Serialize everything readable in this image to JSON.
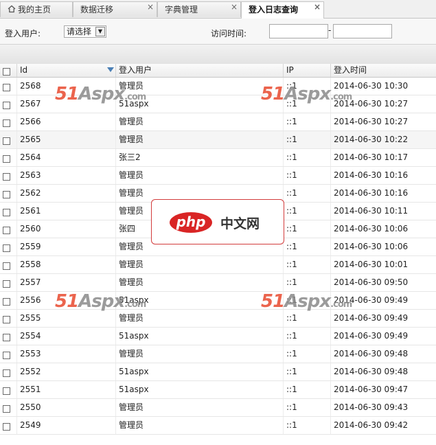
{
  "tabs": [
    {
      "label": "我的主页",
      "icon": "home-icon",
      "closable": false,
      "active": false
    },
    {
      "label": "数据迁移",
      "closable": true,
      "active": false
    },
    {
      "label": "字典管理",
      "closable": true,
      "active": false
    },
    {
      "label": "登入日志查询",
      "closable": true,
      "active": true
    }
  ],
  "close_glyph": "×",
  "filter": {
    "user_label": "登入用户:",
    "user_select_value": "请选择",
    "time_label": "访问时间:",
    "range_separator": "-"
  },
  "grid": {
    "columns": [
      "Id",
      "登入用户",
      "IP",
      "登入时间"
    ],
    "sort_column": "Id",
    "rows": [
      {
        "id": "2568",
        "user": "管理员",
        "ip": "::1",
        "time": "2014-06-30 10:30"
      },
      {
        "id": "2567",
        "user": "51aspx",
        "ip": "::1",
        "time": "2014-06-30 10:27"
      },
      {
        "id": "2566",
        "user": "管理员",
        "ip": "::1",
        "time": "2014-06-30 10:27"
      },
      {
        "id": "2565",
        "user": "管理员",
        "ip": "::1",
        "time": "2014-06-30 10:22"
      },
      {
        "id": "2564",
        "user": "张三2",
        "ip": "::1",
        "time": "2014-06-30 10:17"
      },
      {
        "id": "2563",
        "user": "管理员",
        "ip": "::1",
        "time": "2014-06-30 10:16"
      },
      {
        "id": "2562",
        "user": "管理员",
        "ip": "::1",
        "time": "2014-06-30 10:16"
      },
      {
        "id": "2561",
        "user": "管理员",
        "ip": "::1",
        "time": "2014-06-30 10:11"
      },
      {
        "id": "2560",
        "user": "张四",
        "ip": "::1",
        "time": "2014-06-30 10:06"
      },
      {
        "id": "2559",
        "user": "管理员",
        "ip": "::1",
        "time": "2014-06-30 10:06"
      },
      {
        "id": "2558",
        "user": "管理员",
        "ip": "::1",
        "time": "2014-06-30 10:01"
      },
      {
        "id": "2557",
        "user": "管理员",
        "ip": "::1",
        "time": "2014-06-30 09:50"
      },
      {
        "id": "2556",
        "user": "51aspx",
        "ip": "::1",
        "time": "2014-06-30 09:49"
      },
      {
        "id": "2555",
        "user": "管理员",
        "ip": "::1",
        "time": "2014-06-30 09:49"
      },
      {
        "id": "2554",
        "user": "51aspx",
        "ip": "::1",
        "time": "2014-06-30 09:49"
      },
      {
        "id": "2553",
        "user": "管理员",
        "ip": "::1",
        "time": "2014-06-30 09:48"
      },
      {
        "id": "2552",
        "user": "51aspx",
        "ip": "::1",
        "time": "2014-06-30 09:48"
      },
      {
        "id": "2551",
        "user": "51aspx",
        "ip": "::1",
        "time": "2014-06-30 09:47"
      },
      {
        "id": "2550",
        "user": "管理员",
        "ip": "::1",
        "time": "2014-06-30 09:43"
      },
      {
        "id": "2549",
        "user": "管理员",
        "ip": "::1",
        "time": "2014-06-30 09:42"
      }
    ]
  },
  "watermark": {
    "num": "51",
    "brand": "Aspx",
    "suffix": ".com"
  },
  "overlay_logo": {
    "pill": "php",
    "text": "中文网"
  },
  "colors": {
    "accent": "#4a7fb5",
    "watermark_red": "#e8492f",
    "logo_red": "#d92525"
  }
}
